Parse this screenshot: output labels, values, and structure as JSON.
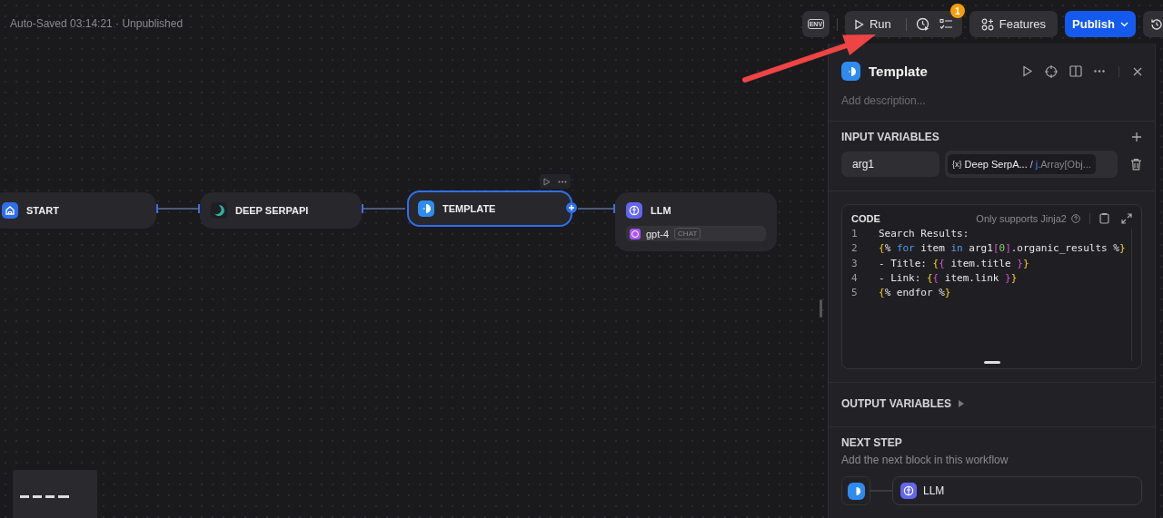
{
  "status": "Auto-Saved 03:14:21 · Unpublished",
  "toolbar": {
    "env": "ENV",
    "run": "Run",
    "badge": "1",
    "features": "Features",
    "publish": "Publish"
  },
  "nodes": [
    {
      "kind": "start",
      "title": "START",
      "selected": false
    },
    {
      "kind": "serpapi",
      "title": "DEEP SERPAPI",
      "selected": false
    },
    {
      "kind": "template",
      "title": "TEMPLATE",
      "selected": true
    },
    {
      "kind": "llm",
      "title": "LLM",
      "selected": false,
      "model": "gpt-4",
      "tag": "CHAT"
    }
  ],
  "panel": {
    "title": "Template",
    "description_placeholder": "Add description...",
    "input_title": "INPUT VARIABLES",
    "variables": [
      {
        "name": "arg1",
        "var_icon": "{x}",
        "source": "Deep SerpA...",
        "sep": "/",
        "prefix": "j.",
        "type": "Array[Obj..."
      }
    ],
    "code": {
      "label": "CODE",
      "hint": "Only supports Jinja2",
      "lines": [
        {
          "no": "1",
          "tokens": [
            {
              "kind": "text",
              "text": "Search Results:"
            }
          ]
        },
        {
          "no": "2",
          "tokens": [
            {
              "kind": "brace",
              "text": "{"
            },
            {
              "kind": "text",
              "text": "% "
            },
            {
              "kind": "keyword",
              "text": "for"
            },
            {
              "kind": "text",
              "text": " item "
            },
            {
              "kind": "keyword",
              "text": "in"
            },
            {
              "kind": "text",
              "text": " arg1"
            },
            {
              "kind": "bracket",
              "text": "["
            },
            {
              "kind": "number",
              "text": "0"
            },
            {
              "kind": "bracket",
              "text": "]"
            },
            {
              "kind": "text",
              "text": ".organic_results %"
            },
            {
              "kind": "brace",
              "text": "}"
            }
          ]
        },
        {
          "no": "3",
          "tokens": [
            {
              "kind": "text",
              "text": "- Title: "
            },
            {
              "kind": "brace",
              "text": "{"
            },
            {
              "kind": "bracket",
              "text": "{"
            },
            {
              "kind": "text",
              "text": " item.title "
            },
            {
              "kind": "bracket",
              "text": "}"
            },
            {
              "kind": "brace",
              "text": "}"
            }
          ]
        },
        {
          "no": "4",
          "tokens": [
            {
              "kind": "text",
              "text": "- Link: "
            },
            {
              "kind": "brace",
              "text": "{"
            },
            {
              "kind": "bracket",
              "text": "{"
            },
            {
              "kind": "text",
              "text": " item.link "
            },
            {
              "kind": "bracket",
              "text": "}"
            },
            {
              "kind": "brace",
              "text": "}"
            }
          ]
        },
        {
          "no": "5",
          "tokens": [
            {
              "kind": "brace",
              "text": "{"
            },
            {
              "kind": "text",
              "text": "% endfor %"
            },
            {
              "kind": "brace",
              "text": "}"
            }
          ]
        }
      ]
    },
    "output_title": "OUTPUT VARIABLES",
    "output_expanded": false,
    "next_title": "NEXT STEP",
    "next_hint": "Add the next block in this workflow",
    "next_block": "LLM"
  }
}
